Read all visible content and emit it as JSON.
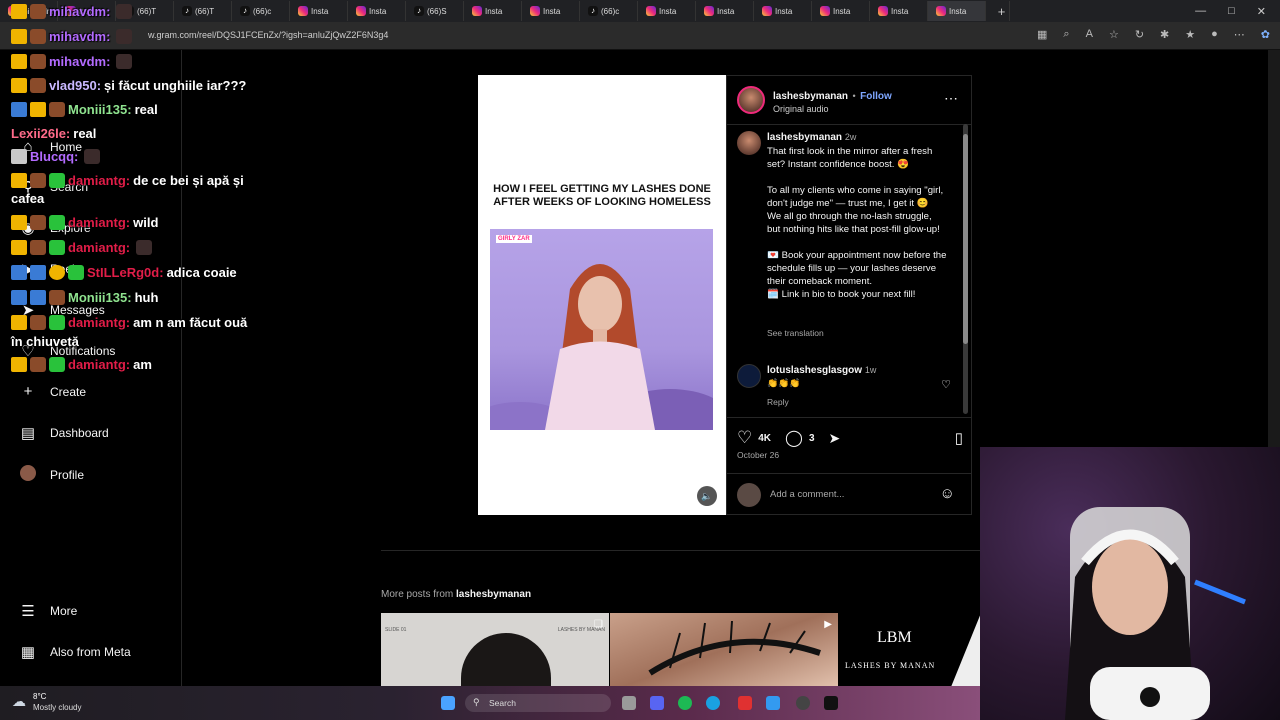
{
  "browser": {
    "tabs": [
      {
        "label": "mihavdm",
        "icon": "instagram-icon"
      },
      {
        "label": "Insta",
        "icon": "instagram-icon"
      },
      {
        "label": "(66)T",
        "icon": "tiktok-icon"
      },
      {
        "label": "(66)T",
        "icon": "tiktok-icon"
      },
      {
        "label": "(66)c",
        "icon": "tiktok-icon"
      },
      {
        "label": "Insta",
        "icon": "instagram-icon"
      },
      {
        "label": "Insta",
        "icon": "instagram-icon"
      },
      {
        "label": "(66)S",
        "icon": "tiktok-icon"
      },
      {
        "label": "Insta",
        "icon": "instagram-icon"
      },
      {
        "label": "Insta",
        "icon": "instagram-icon"
      },
      {
        "label": "(66)c",
        "icon": "tiktok-icon"
      },
      {
        "label": "Insta",
        "icon": "instagram-icon"
      },
      {
        "label": "Insta",
        "icon": "instagram-icon"
      },
      {
        "label": "Insta",
        "icon": "instagram-icon"
      },
      {
        "label": "Insta",
        "icon": "instagram-icon"
      },
      {
        "label": "Insta",
        "icon": "instagram-icon"
      },
      {
        "label": "Insta",
        "icon": "instagram-icon"
      }
    ],
    "url": "w.gram.com/reel/DQSJ1FCEnZx/?igsh=anluZjQwZ2F6N3g4",
    "new_tab": "+"
  },
  "nav": {
    "home": "Home",
    "search": "Search",
    "explore": "Explore",
    "reels": "Reels",
    "messages": "Messages",
    "notifications": "Notifications",
    "create": "Create",
    "dashboard": "Dashboard",
    "profile": "Profile",
    "more": "More",
    "meta": "Also from Meta"
  },
  "chat": [
    {
      "user": "mihavdm:",
      "msg": ""
    },
    {
      "user": "mihavdm:",
      "msg": ""
    },
    {
      "user": "mihavdm:",
      "msg": ""
    },
    {
      "user": "vlad950:",
      "msg": "și făcut unghiile iar???"
    },
    {
      "user": "Moniii135:",
      "msg": "real"
    },
    {
      "user": "Lexii26le:",
      "msg": "real"
    },
    {
      "user": "Blucqq:",
      "msg": ""
    },
    {
      "user": "damiantg:",
      "msg": "de ce bei și apă și"
    },
    {
      "user": "",
      "msg": "cafea"
    },
    {
      "user": "damiantg:",
      "msg": "wild"
    },
    {
      "user": "damiantg:",
      "msg": ""
    },
    {
      "user": "StILLeRg0d:",
      "msg": "adica coaie"
    },
    {
      "user": "Moniii135:",
      "msg": "huh"
    },
    {
      "user": "damiantg:",
      "msg": "am n am făcut ouă"
    },
    {
      "user": "",
      "msg": "în chiuvetă"
    },
    {
      "user": "damiantg:",
      "msg": "am"
    }
  ],
  "post": {
    "reel_caption": "HOW I FEEL GETTING MY LASHES DONE AFTER WEEKS OF LOOKING HOMELESS",
    "sticker": "GIRLY ZAR",
    "username": "lashesbymanan",
    "follow": "Follow",
    "dot": "•",
    "audio": "Original audio",
    "caption_user": "lashesbymanan",
    "caption_age": "2w",
    "caption": "That first look in the mirror after a fresh set? Instant confidence boost. 😍\n\nTo all my clients who come in saying \"girl, don't judge me\" — trust me, I get it 😊\nWe all go through the no-lash struggle, but nothing hits like that post-fill glow-up!\n\n💌 Book your appointment now before the schedule fills up — your lashes deserve their comeback moment.\n🗓️ Link in bio to book your next fill!",
    "see_translation": "See translation",
    "comment_user": "lotuslashesglasgow",
    "comment_age": "1w",
    "comment_text": "👏👏👏",
    "reply": "Reply",
    "likes": "4K",
    "comments": "3",
    "date": "October 26",
    "add_comment": "Add a comment..."
  },
  "more_posts": {
    "prefix": "More posts from",
    "user": "lashesbymanan",
    "thumb1_a": "SLIDE 01",
    "thumb1_b": "LASHES BY MANAN",
    "thumb3_logo": "LBM",
    "thumb3_text": "LASHES BY MANAN"
  },
  "taskbar": {
    "temp": "8°C",
    "weather": "Mostly cloudy",
    "search": "Search"
  }
}
